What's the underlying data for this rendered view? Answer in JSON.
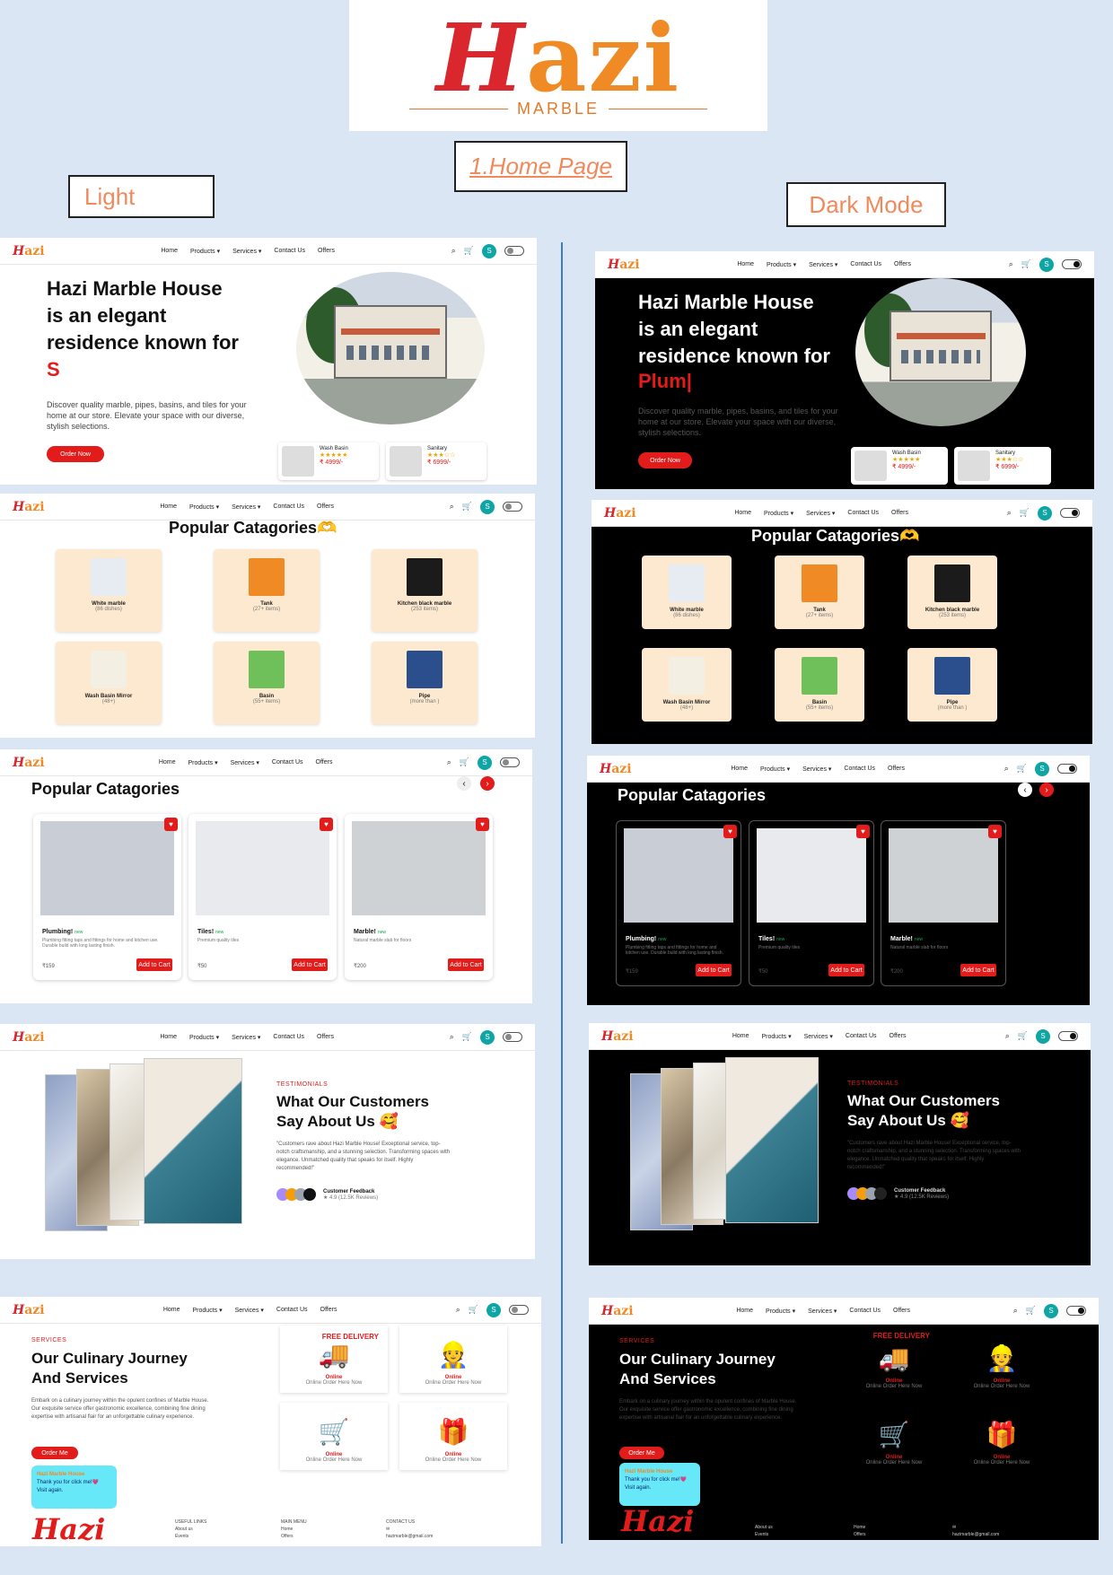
{
  "logo": {
    "mark_h": "H",
    "mark_rest": "azi",
    "sub": "MARBLE"
  },
  "labels": {
    "home": "1.Home Page",
    "light": "Light",
    "dark": "Dark Mode"
  },
  "nav": {
    "logo_h": "H",
    "logo_rest": "azi",
    "links": [
      "Home",
      "Products ▾",
      "Services ▾",
      "Contact Us",
      "Offers"
    ],
    "avatar": "S"
  },
  "hero": {
    "line1": "Hazi Marble House",
    "line2": "is an elegant",
    "line3": "residence known for",
    "typed_light": "S",
    "typed_dark": "Plum|",
    "desc": "Discover quality marble, pipes, basins, and tiles for your home at our store. Elevate your space with our diverse, stylish selections.",
    "cta": "Order Now",
    "cards": [
      {
        "name": "Wash Basin",
        "stars": "★★★★★",
        "price": "₹ 4999/-"
      },
      {
        "name": "Sanitary",
        "stars": "★★★☆☆",
        "price": "₹ 6999/-"
      }
    ]
  },
  "categories": {
    "title": "Popular Catagories🫶",
    "items": [
      {
        "name": "White marble",
        "count": "(86 dishes)",
        "color": "#e6ecf2"
      },
      {
        "name": "Tank",
        "count": "(27+ items)",
        "color": "#f08a24"
      },
      {
        "name": "Kitchen black marble",
        "count": "(253 items)",
        "color": "#1b1b1b"
      },
      {
        "name": "Wash Basin Mirror",
        "count": "(48+)",
        "color": "#f3efe2"
      },
      {
        "name": "Basin",
        "count": "(55+ items)",
        "color": "#6fbf5a"
      },
      {
        "name": "Pipe",
        "count": "(more than )",
        "color": "#2b4f8c"
      }
    ]
  },
  "products": {
    "title": "Popular Catagories",
    "prev": "‹",
    "next": "›",
    "heart": "♥",
    "add": "Add to Cart",
    "items": [
      {
        "name": "Plumbing!",
        "tag": "new",
        "desc": "Plumbing fitting taps and fittings for home and kitchen use. Durable build with long lasting finish.",
        "price": "₹159",
        "color": "#c9ced6"
      },
      {
        "name": "Tiles!",
        "tag": "new",
        "desc": "Premium quality tiles",
        "price": "₹50",
        "color": "#e8eaee"
      },
      {
        "name": "Marble!",
        "tag": "new",
        "desc": "Natural marble slab for floors",
        "price": "₹200",
        "color": "#cfd2d4"
      }
    ]
  },
  "testimonials": {
    "eyebrow": "TESTIMONIALS",
    "title1": "What Our Customers",
    "title2": "Say About Us 🥰",
    "text": "\"Customers rave about Hazi Marble House! Exceptional service, top-notch craftsmanship, and a stunning selection. Transforming spaces with elegance. Unmatched quality that speaks for itself. Highly recommended!\"",
    "feedback_label": "Customer Feedback",
    "rating": "★ 4.9 (12.5K Reviews)"
  },
  "services": {
    "eyebrow": "SERVICES",
    "title1": "Our Culinary Journey",
    "title2": "And Services",
    "desc": "Embark on a culinary journey within the opulent confines of Marble House. Our exquisite service offer gastronomic excellence, combining fine dining expertise with artisanal flair for an unforgettable culinary experience.",
    "cta": "Order Me",
    "cards": [
      {
        "icon": "🚚",
        "badge": "FREE DELIVERY",
        "title": "Online",
        "sub": "Online Order Here Now"
      },
      {
        "icon": "👷",
        "title": "Online",
        "sub": "Online Order Here Now"
      },
      {
        "icon": "🛒",
        "title": "Online",
        "sub": "Online Order Here Now"
      },
      {
        "icon": "🎁",
        "title": "Online",
        "sub": "Online Order Here Now"
      }
    ],
    "chat": {
      "title": "Hazi Marble House",
      "line1": "Thank you for click me!💗",
      "line2": "Visit again."
    }
  },
  "footer": {
    "logo": "Hazi",
    "col1_title": "USEFUL LINKS",
    "col1": [
      "About us",
      "Events"
    ],
    "col2_title": "MAIN MENU",
    "col2": [
      "Home",
      "Offers"
    ],
    "col3_title": "CONTACT US",
    "col3": [
      "✉",
      "hazimarble@gmail.com",
      "☎"
    ]
  },
  "colors": {
    "accent": "#e21b1b",
    "brand_orange": "#f08a24",
    "teal": "#0ea5a4",
    "cream": "#fde9cf"
  }
}
